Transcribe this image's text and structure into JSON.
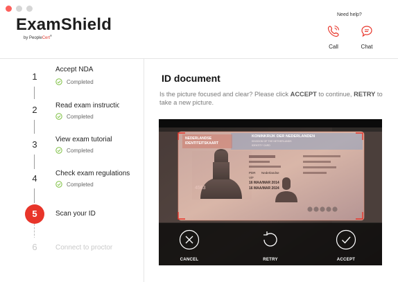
{
  "app": {
    "name": "ExamShield",
    "by_prefix": "by People",
    "by_brand": "Cert",
    "registered": "®"
  },
  "help": {
    "title": "Need help?",
    "call_label": "Call",
    "chat_label": "Chat"
  },
  "colors": {
    "accent": "#e8352a",
    "completed": "#7cbf3f"
  },
  "steps": [
    {
      "num": "1",
      "title": "Accept NDA",
      "status": "Completed",
      "state": "completed"
    },
    {
      "num": "2",
      "title": "Read exam instructions",
      "status": "Completed",
      "state": "completed"
    },
    {
      "num": "3",
      "title": "View exam tutorial",
      "status": "Completed",
      "state": "completed"
    },
    {
      "num": "4",
      "title": "Check exam regulations",
      "status": "Completed",
      "state": "completed"
    },
    {
      "num": "5",
      "title": "Scan your ID",
      "status": "",
      "state": "active"
    },
    {
      "num": "6",
      "title": "Connect to proctor",
      "status": "",
      "state": "disabled"
    }
  ],
  "main": {
    "title": "ID document",
    "instruction_pre": "Is the picture focused and clear? Please click ",
    "accept_word": "ACCEPT",
    "instruction_mid": " to continue, ",
    "retry_word": "RETRY",
    "instruction_post": " to take a new picture."
  },
  "id_card": {
    "country": "NEDERLANDSE",
    "card_type": "IDENTITEITSKAART",
    "kingdom": "KONINKRIJK DER NEDERLANDEN",
    "kingdom_en": "KINGDOM OF THE NETHERLANDS",
    "card_en": "IDENTITY CARD",
    "name_field": "PDR",
    "nationality": "Nederlandse",
    "sex": "V/F",
    "issue_date": "16 MAA/MAR 2014",
    "expiry_date": "16 MAA/MAR 2024",
    "card_no": "4563"
  },
  "actions": {
    "cancel": "CANCEL",
    "retry": "RETRY",
    "accept": "ACCEPT"
  }
}
